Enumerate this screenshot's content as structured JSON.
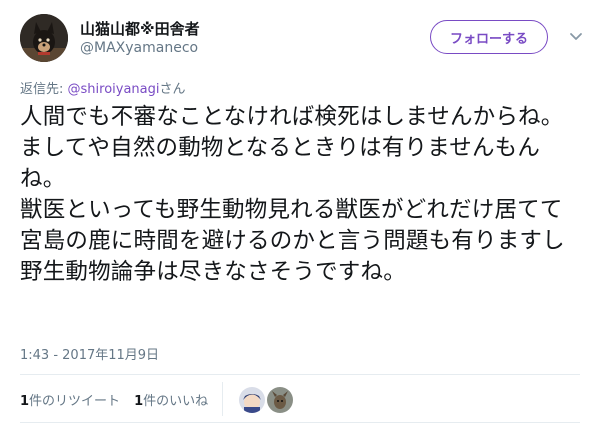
{
  "author": {
    "name": "山猫山都※田舎者",
    "handle": "@MAXyamaneco"
  },
  "follow_button": {
    "label": "フォローする"
  },
  "reply": {
    "prefix": "返信先: ",
    "target": "@shiroiyanagi",
    "suffix": "さん"
  },
  "tweet": {
    "text": "人間でも不審なことなければ検死はしませんからね。ましてや自然の動物となるときりは有りませんもんね。\n獣医といっても野生動物見れる獣医がどれだけ居てて宮島の鹿に時間を避けるのかと言う問題も有りますし\n野生動物論争は尽きなさそうですね。"
  },
  "timestamp": "1:43 - 2017年11月9日",
  "stats": {
    "retweets_count": "1",
    "retweets_label": "件のリツイート",
    "likes_count": "1",
    "likes_label": "件のいいね"
  },
  "icons": {
    "chevron": "chevron-down-icon"
  },
  "colors": {
    "accent": "#794bc4",
    "text": "#14171a",
    "muted": "#657786"
  }
}
